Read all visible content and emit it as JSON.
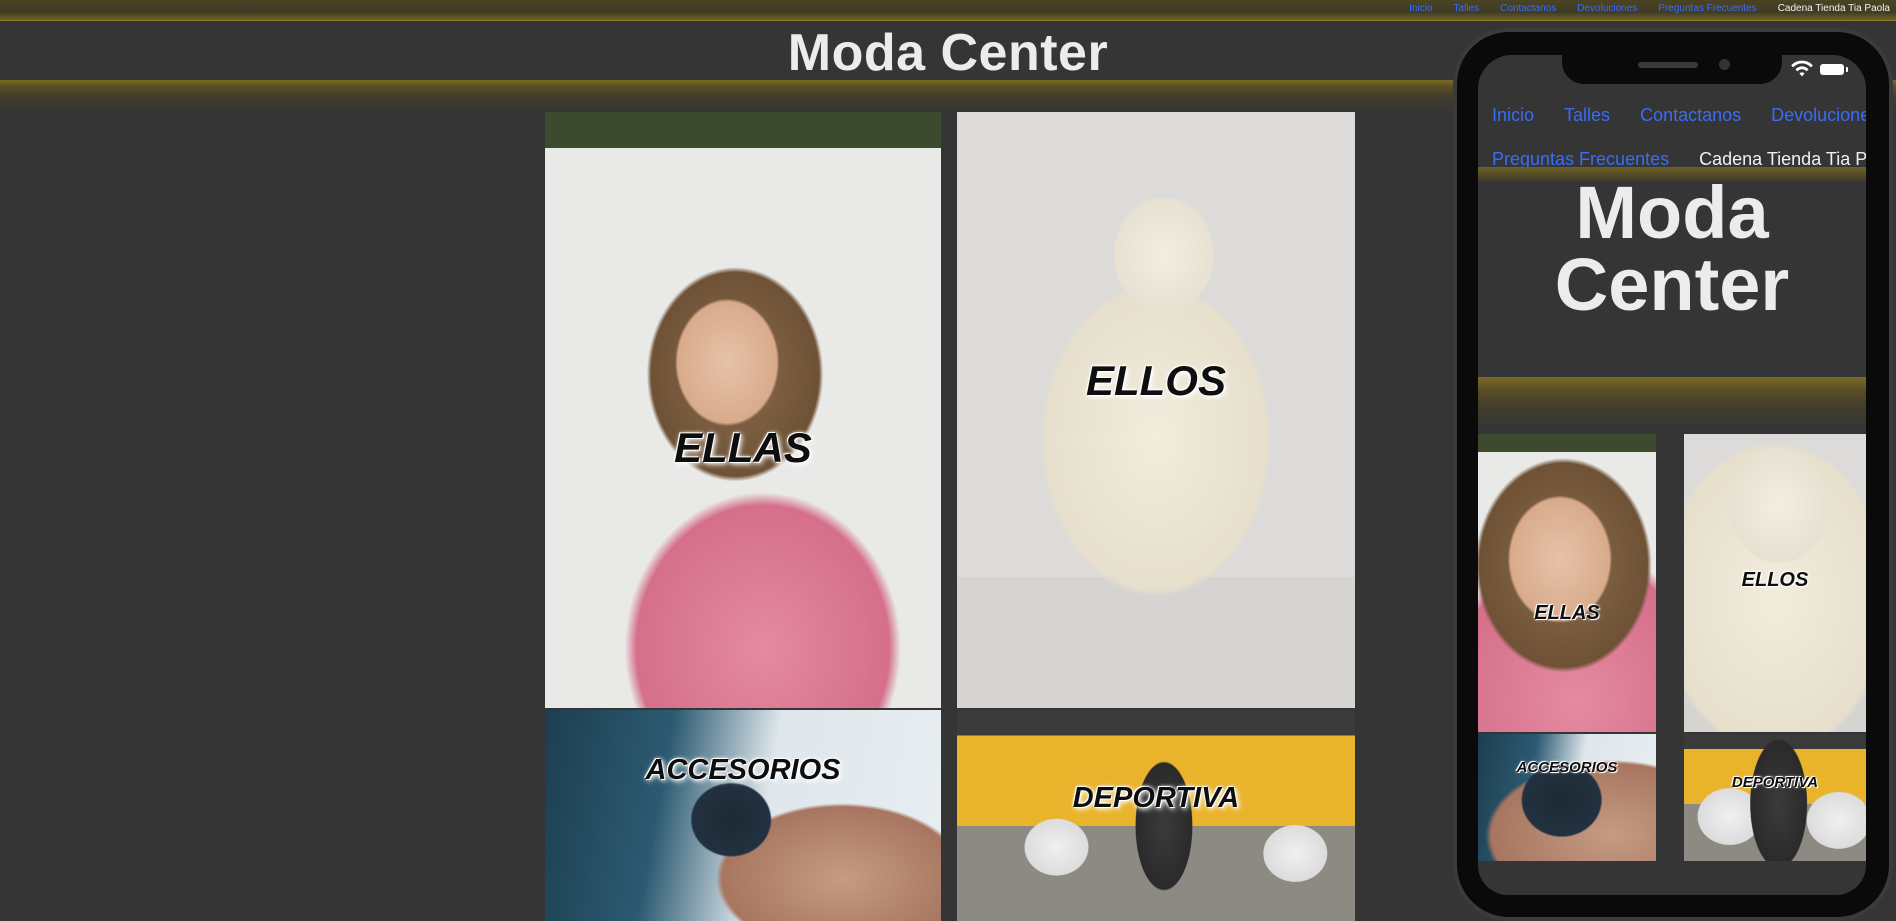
{
  "nav": {
    "items": [
      {
        "label": "Inicio",
        "style": "link"
      },
      {
        "label": "Talles",
        "style": "link"
      },
      {
        "label": "Contactanos",
        "style": "link"
      },
      {
        "label": "Devoluciones",
        "style": "link"
      },
      {
        "label": "Preguntas Frecuentes",
        "style": "link"
      },
      {
        "label": "Cadena Tienda Tia Paola",
        "style": "plain"
      }
    ]
  },
  "header": {
    "title": "Moda Center"
  },
  "categories": [
    {
      "label": "ELLAS",
      "image": "woman-pink-shirt-photo"
    },
    {
      "label": "ELLOS",
      "image": "man-white-hoodie-photo"
    },
    {
      "label": "ACCESORIOS",
      "image": "smartwatch-photo"
    },
    {
      "label": "DEPORTIVA",
      "image": "gym-workout-photo"
    }
  ],
  "mobile_preview": {
    "nav_items": [
      {
        "label": "Inicio",
        "style": "link"
      },
      {
        "label": "Talles",
        "style": "link"
      },
      {
        "label": "Contactanos",
        "style": "link"
      },
      {
        "label": "Devoluciones",
        "style": "link"
      },
      {
        "label": "Preguntas Frecuentes",
        "style": "link"
      },
      {
        "label": "Cadena Tienda Tia Paola",
        "style": "plain"
      }
    ],
    "title_line1": "Moda",
    "title_line2": "Center",
    "categories": [
      "ELLAS",
      "ELLOS",
      "ACCESORIOS",
      "DEPORTIVA"
    ]
  },
  "colors": {
    "background": "#353535",
    "nav_link": "#3a6cf5",
    "accent_gold": "#7b6a24",
    "title_text": "#ececec"
  }
}
